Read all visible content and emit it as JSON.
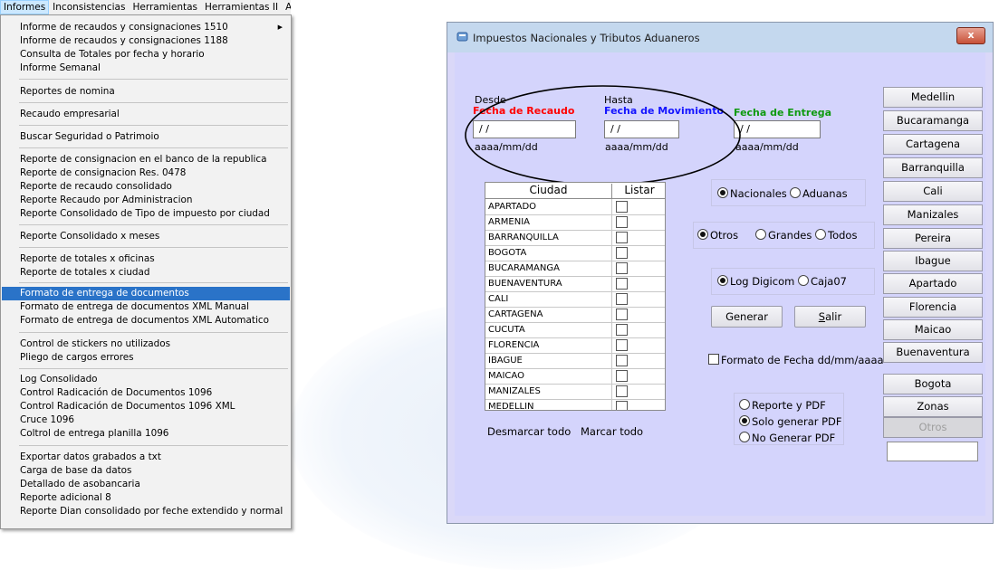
{
  "menubar": {
    "items": [
      "Informes",
      "Inconsistencias",
      "Herramientas",
      "Herramientas II",
      "Adminis"
    ]
  },
  "dropdown": {
    "items": [
      "Informe de recaudos y consignaciones 1510",
      "Informe de recaudos y consignaciones 1188",
      "Consulta de Totales por fecha y horario",
      "Informe Semanal",
      "Reportes de nomina",
      "Recaudo empresarial",
      "Buscar Seguridad o Patrimoio",
      "Reporte de consignacion en el banco de la republica",
      "Reporte de consignacion Res. 0478",
      "Reporte de recaudo consolidado",
      "Reporte Recaudo por Administracion",
      "Reporte Consolidado de Tipo de impuesto por ciudad",
      "Reporte Consolidado x meses",
      "Reporte de totales x oficinas",
      "Reporte de totales x ciudad",
      "Formato de entrega de documentos",
      "Formato de entrega de documentos XML Manual",
      "Formato de entrega de documentos XML Automatico",
      "Control de stickers no utilizados",
      "Pliego de cargos errores",
      "Log Consolidado",
      "Control Radicación de Documentos 1096",
      "Control Radicación de Documentos 1096 XML",
      "Cruce 1096",
      "Coltrol de entrega planilla 1096",
      "Exportar datos grabados a txt",
      "Carga de base da datos",
      "Detallado de asobancaria",
      "Reporte adicional 8",
      "Reporte Dian consolidado  por feche extendido y normal"
    ],
    "highlighted": "Formato de entrega de documentos"
  },
  "dialog": {
    "title": "Impuestos Nacionales y Tributos Aduaneros",
    "close_label": "x",
    "desde": "Desde",
    "hasta": "Hasta",
    "fecha_recaudo": "Fecha de Recaudo",
    "fecha_movimiento": "Fecha de Movimiento",
    "fecha_entrega": "Fecha de Entrega",
    "date_value": " / /",
    "date_format": "aaaa/mm/dd",
    "city_list": {
      "col_ciudad": "Ciudad",
      "col_listar": "Listar",
      "rows": [
        "APARTADO",
        "ARMENIA",
        "BARRANQUILLA",
        "BOGOTA",
        "BUCARAMANGA",
        "BUENAVENTURA",
        "CALI",
        "CARTAGENA",
        "CUCUTA",
        "FLORENCIA",
        "IBAGUE",
        "MAICAO",
        "MANIZALES",
        "MEDELLIN"
      ]
    },
    "desmarcar": "Desmarcar todo",
    "marcar": "Marcar todo",
    "opt_nacionales": "Nacionales",
    "opt_aduanas": "Aduanas",
    "opt_otros": "Otros",
    "opt_grandes": "Grandes",
    "opt_todos": "Todos",
    "opt_log": "Log Digicom",
    "opt_caja": "Caja07",
    "generar": "Generar",
    "salir_prefix": "",
    "salir_ul": "S",
    "salir_rest": "alir",
    "formato_fecha": "Formato de Fecha dd/mm/aaaa",
    "opt_reporte_pdf": "Reporte y PDF",
    "opt_solo_pdf": "Solo generar PDF",
    "opt_no_pdf": "No Generar PDF",
    "city_buttons": [
      "Medellin",
      "Bucaramanga",
      "Cartagena",
      "Barranquilla",
      "Cali",
      "Manizales",
      "Pereira",
      "Ibague",
      "Apartado",
      "Florencia",
      "Maicao",
      "Buenaventura"
    ],
    "extra_buttons": [
      "Bogota",
      "Zonas",
      "Otros"
    ]
  }
}
